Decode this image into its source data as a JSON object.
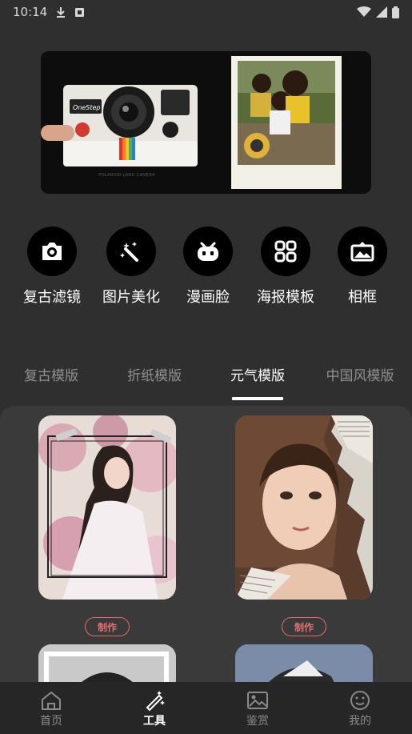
{
  "status_bar": {
    "time": "10:14"
  },
  "banner": {
    "brand_label": "OneStep",
    "camera_caption": "POLAROID LAND CAMERA"
  },
  "tools": [
    {
      "label": "复古滤镜",
      "icon": "camera-icon"
    },
    {
      "label": "图片美化",
      "icon": "magic-wand-icon"
    },
    {
      "label": "漫画脸",
      "icon": "robot-face-icon"
    },
    {
      "label": "海报模板",
      "icon": "grid-icon"
    },
    {
      "label": "相框",
      "icon": "picture-frame-icon"
    }
  ],
  "tabs": [
    {
      "label": "复古模版",
      "active": false
    },
    {
      "label": "折纸模版",
      "active": false
    },
    {
      "label": "元气模版",
      "active": true
    },
    {
      "label": "中国风模版",
      "active": false
    }
  ],
  "templates": [
    {
      "button_label": "制作"
    },
    {
      "button_label": "制作"
    }
  ],
  "nav": [
    {
      "label": "首页",
      "icon": "home-icon",
      "active": false
    },
    {
      "label": "工具",
      "icon": "magic-pen-icon",
      "active": true
    },
    {
      "label": "鉴赏",
      "icon": "image-icon",
      "active": false
    },
    {
      "label": "我的",
      "icon": "smiley-icon",
      "active": false
    }
  ],
  "colors": {
    "accent": "#e26a6a",
    "background": "#2f2f2f",
    "panel": "#3a3a3a"
  }
}
